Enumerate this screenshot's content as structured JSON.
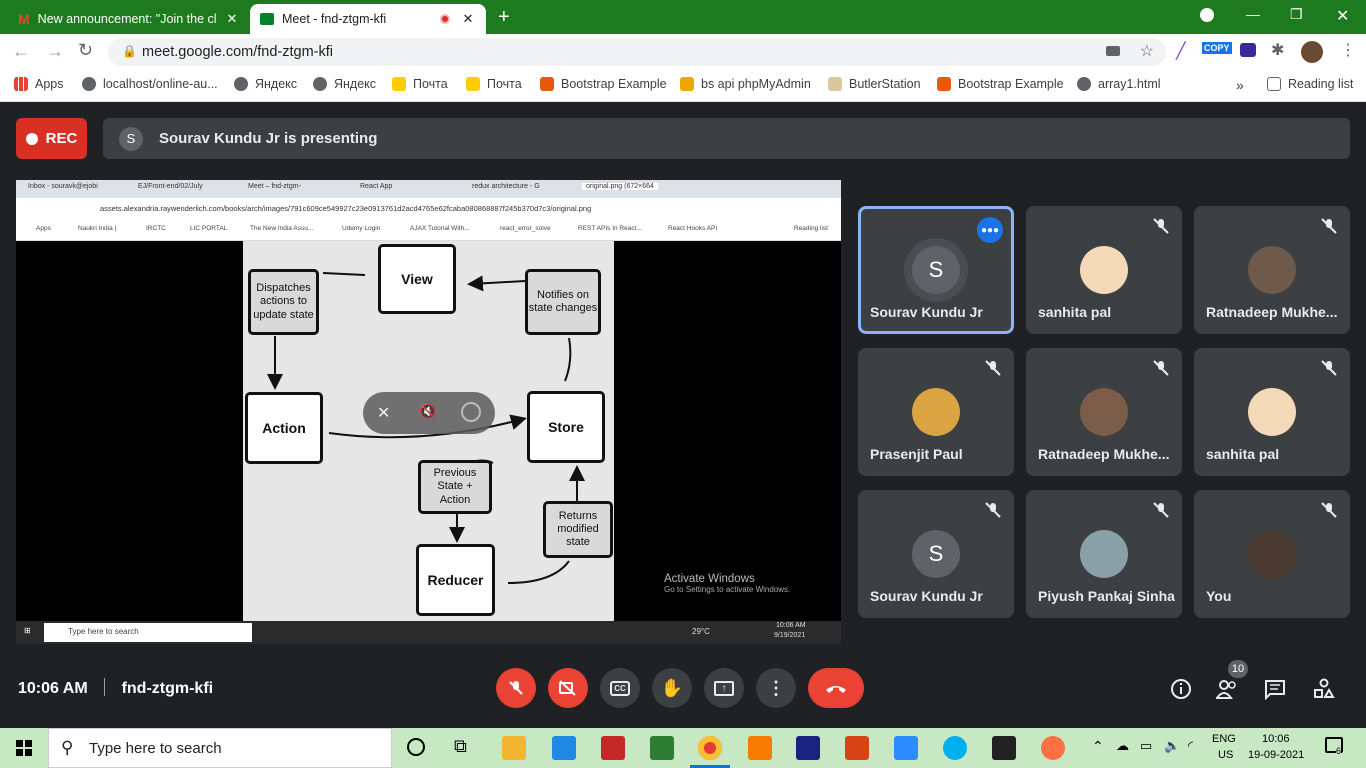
{
  "browser": {
    "tabs": [
      {
        "title": "New announcement: \"Join the cl",
        "favicon": "gmail-icon"
      },
      {
        "title": "Meet - fnd-ztgm-kfi",
        "favicon": "meet-icon",
        "recording": true
      }
    ],
    "url": "meet.google.com/fnd-ztgm-kfi",
    "extension_label": "COPY",
    "bookmarks": [
      "Apps",
      "localhost/online-au...",
      "Яндекс",
      "Яндекс",
      "Почта",
      "Почта",
      "Bootstrap Example",
      "bs api phpMyAdmin",
      "ButlerStation",
      "Bootstrap Example",
      "array1.html"
    ],
    "more": "»",
    "reading_list": "Reading list"
  },
  "meet": {
    "rec_label": "REC",
    "presenter_initial": "S",
    "presenting_text": "Sourav Kundu Jr is presenting",
    "time": "10:06 AM",
    "meeting_code": "fnd-ztgm-kfi",
    "people_count": "10",
    "participants": [
      {
        "name": "Sourav Kundu Jr",
        "initial": "S",
        "speaking": true
      },
      {
        "name": "sanhita pal",
        "initial": ""
      },
      {
        "name": "Ratnadeep Mukhe...",
        "initial": ""
      },
      {
        "name": "Prasenjit Paul",
        "initial": ""
      },
      {
        "name": "Ratnadeep Mukhe...",
        "initial": ""
      },
      {
        "name": "sanhita pal",
        "initial": ""
      },
      {
        "name": "Sourav Kundu Jr",
        "initial": "S"
      },
      {
        "name": "Piyush Pankaj Sinha",
        "initial": ""
      },
      {
        "name": "You",
        "initial": ""
      }
    ]
  },
  "shared_screen": {
    "tabs": [
      "Inbox - souravk@ejobi",
      "EJ/Front-end/02/July",
      "Meet – fnd-ztgm-",
      "React App",
      "redux architecture - G",
      "original.png (672×664"
    ],
    "url": "assets.alexandria.raywenderlich.com/books/arch/images/791c609ce549927c23e0913761d2acd4765e62fcaba080868887f245b370d7c3/original.png",
    "bookmarks": [
      "Apps",
      "Naukri India |",
      "IRCTC",
      "LIC PORTAL",
      "The New India Assu...",
      "Udemy Login",
      "AJAX Tutorial With...",
      "react_error_solve",
      "REST APIs In React...",
      "React Hooks API"
    ],
    "reading_list": "Reading list",
    "diagram": {
      "view": "View",
      "action": "Action",
      "store": "Store",
      "reducer": "Reducer",
      "dispatches": "Dispatches actions to update state",
      "notifies": "Notifies on state changes",
      "previous": "Previous State + Action",
      "returns": "Returns modified state"
    },
    "activate_title": "Activate Windows",
    "activate_sub": "Go to Settings to activate Windows.",
    "taskbar_search": "Type here to search",
    "temp": "29°C",
    "time": "10:06 AM",
    "date": "9/19/2021"
  },
  "taskbar": {
    "search_placeholder": "Type here to search",
    "lang": "ENG",
    "region": "US",
    "time": "10:06",
    "date": "19-09-2021",
    "notifications": "6"
  },
  "colors": {
    "chrome_tab_bg": "#1e7a1e",
    "rec_red": "#d93025",
    "end_call": "#ea4335",
    "speaking_border": "#8ab4f8",
    "taskbar": "#c7e8c3"
  }
}
